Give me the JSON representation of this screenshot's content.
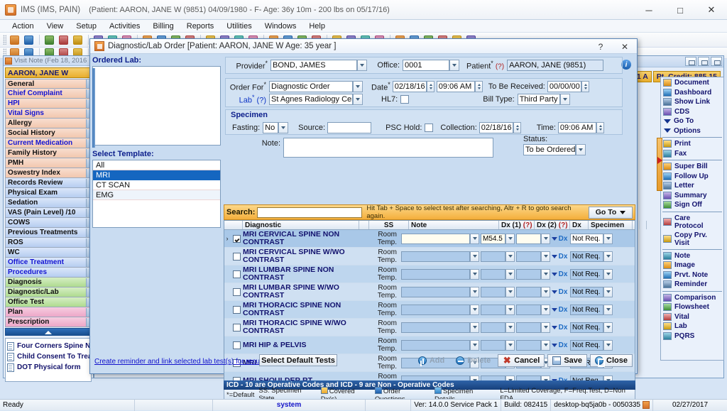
{
  "app": {
    "title": "IMS (IMS, PAIN)",
    "patient_header": "(Patient: AARON, JANE W (9851) 04/09/1980 - F- Age: 36y 10m - 200 lbs on 05/17/16)",
    "window_controls": [
      "minimize-icon",
      "maximize-icon",
      "close-icon"
    ]
  },
  "menu": [
    "Action",
    "View",
    "Setup",
    "Activities",
    "Billing",
    "Reports",
    "Utilities",
    "Windows",
    "Help"
  ],
  "visit_note": {
    "window_title": "Visit Note (Feb 18, 2016",
    "patient": "AARON, JANE W",
    "items": [
      {
        "label": "General",
        "style": "orange",
        "color": "black"
      },
      {
        "label": "Chief Complaint",
        "style": "orange",
        "color": "blue"
      },
      {
        "label": "HPI",
        "style": "orange",
        "color": "blue"
      },
      {
        "label": "Vital Signs",
        "style": "orange",
        "color": "blue"
      },
      {
        "label": "Allergy",
        "style": "orange",
        "color": "black"
      },
      {
        "label": "Social History",
        "style": "orange",
        "color": "black"
      },
      {
        "label": "Current Medication",
        "style": "orange",
        "color": "blue"
      },
      {
        "label": "Family History",
        "style": "orange",
        "color": "black"
      },
      {
        "label": "PMH",
        "style": "orange",
        "color": "black"
      },
      {
        "label": "Oswestry Index",
        "style": "orange",
        "color": "black"
      },
      {
        "label": "Records Review",
        "style": "blue",
        "color": "black"
      },
      {
        "label": "Physical Exam",
        "style": "blue",
        "color": "black"
      },
      {
        "label": "Sedation",
        "style": "blue",
        "color": "black"
      },
      {
        "label": "VAS (Pain Level)  /10",
        "style": "blue",
        "color": "black"
      },
      {
        "label": "COWS",
        "style": "blue",
        "color": "black"
      },
      {
        "label": "Previous Treatments",
        "style": "blue",
        "color": "black"
      },
      {
        "label": "ROS",
        "style": "blue",
        "color": "black"
      },
      {
        "label": "WC",
        "style": "blue",
        "color": "black"
      },
      {
        "label": "Office Treatment",
        "style": "blue",
        "color": "blue"
      },
      {
        "label": "Procedures",
        "style": "blue",
        "color": "blue"
      },
      {
        "label": "Diagnosis",
        "style": "green",
        "color": "black"
      },
      {
        "label": "Diagnostic/Lab",
        "style": "green",
        "color": "black"
      },
      {
        "label": "Office Test",
        "style": "green",
        "color": "black"
      },
      {
        "label": "Plan",
        "style": "pink",
        "color": "black"
      },
      {
        "label": "Prescription",
        "style": "pink",
        "color": "black"
      }
    ],
    "documents": [
      "Four Corners Spine New",
      "Child Consent To Treat",
      "DOT Physical form"
    ]
  },
  "patient_bar": {
    "room": "1 A",
    "credit": "Pt. Credit: 885.15"
  },
  "right_sidebar": {
    "items": [
      {
        "label": "Document",
        "icon": "document-icon",
        "type": "icon"
      },
      {
        "label": "Dashboard",
        "icon": "dashboard-icon",
        "type": "icon"
      },
      {
        "label": "Show Link",
        "icon": "link-icon",
        "type": "icon"
      },
      {
        "label": "CDS",
        "icon": "cds-icon",
        "type": "icon"
      },
      {
        "label": "Go To",
        "icon": "caret-down-icon",
        "type": "caret"
      },
      {
        "label": "Options",
        "icon": "caret-down-icon",
        "type": "caret"
      },
      {
        "label": "Print",
        "icon": "print-icon",
        "type": "icon",
        "divider_before": true
      },
      {
        "label": "Fax",
        "icon": "fax-icon",
        "type": "icon"
      },
      {
        "label": "Super Bill",
        "icon": "superbill-icon",
        "type": "icon",
        "divider_before": true
      },
      {
        "label": "Follow Up",
        "icon": "calendar-icon",
        "type": "icon"
      },
      {
        "label": "Letter",
        "icon": "letter-icon",
        "type": "icon"
      },
      {
        "label": "Summary",
        "icon": "summary-icon",
        "type": "icon"
      },
      {
        "label": "Sign Off",
        "icon": "signoff-icon",
        "type": "icon"
      },
      {
        "label": "Care Protocol",
        "icon": "care-protocol-icon",
        "type": "icon2",
        "divider_before": true
      },
      {
        "label": "Copy Prv. Visit",
        "icon": "copy-icon",
        "type": "icon2"
      },
      {
        "label": "Note",
        "icon": "note-icon",
        "type": "icon",
        "divider_before": true
      },
      {
        "label": "Image",
        "icon": "image-icon",
        "type": "icon"
      },
      {
        "label": "Prvt. Note",
        "icon": "private-note-icon",
        "type": "icon"
      },
      {
        "label": "Reminder",
        "icon": "reminder-icon",
        "type": "icon"
      },
      {
        "label": "Comparison",
        "icon": "comparison-icon",
        "type": "icon",
        "divider_before": true
      },
      {
        "label": "Flowsheet",
        "icon": "flowsheet-icon",
        "type": "icon"
      },
      {
        "label": "Vital",
        "icon": "vital-icon",
        "type": "icon"
      },
      {
        "label": "Lab",
        "icon": "lab-icon",
        "type": "icon"
      },
      {
        "label": "PQRS",
        "icon": "pqrs-icon",
        "type": "icon"
      }
    ]
  },
  "dialog": {
    "title": "Diagnostic/Lab Order  [Patient: AARON, JANE W  Age: 35 year ]",
    "help_label": "?",
    "close_label": "✕",
    "ordered_lab_label": "Ordered Lab:",
    "select_template_label": "Select Template:",
    "templates": [
      {
        "label": "All",
        "selected": false
      },
      {
        "label": "MRI",
        "selected": true
      },
      {
        "label": "CT SCAN",
        "selected": false
      },
      {
        "label": "EMG",
        "selected": false
      }
    ],
    "form": {
      "provider_label": "Provider",
      "provider_value": "BOND, JAMES",
      "office_label": "Office:",
      "office_value": "0001",
      "patient_label": "Patient",
      "patient_hint": "(?)",
      "patient_value": "AARON, JANE  (9851)",
      "order_for_label": "Order For",
      "order_for_value": "Diagnostic Order",
      "date_label": "Date",
      "date_value": "02/18/16",
      "time_value": "09:06 AM",
      "to_be_received_label": "To Be Received:",
      "to_be_received_value": "00/00/00",
      "lab_label": "Lab",
      "lab_hint": "(?)",
      "lab_value": "St Agnes Radiology Center",
      "hl7_label": "HL7:",
      "bill_type_label": "Bill Type:",
      "bill_type_value": "Third Party",
      "specimen_label": "Specimen",
      "fasting_label": "Fasting:",
      "fasting_value": "No",
      "source_label": "Source:",
      "source_value": "",
      "psc_hold_label": "PSC Hold:",
      "collection_label": "Collection:",
      "collection_value": "02/18/16",
      "coll_time_label": "Time:",
      "coll_time_value": "09:06 AM",
      "note_label": "Note:",
      "note_value": "",
      "status_label": "Status:",
      "status_value": "To be Ordered",
      "info_icon": "info-icon"
    },
    "search": {
      "label": "Search:",
      "value": "",
      "hint": "Hit Tab + Space to select test after searching, Altr + R to goto search again.",
      "goto_label": "Go To"
    },
    "grid": {
      "columns": [
        "",
        "",
        "Diagnostic",
        "",
        "SS",
        "Note",
        "Dx (1)",
        "(?)",
        "Dx (2)",
        "(?)",
        "Dx",
        "Specimen",
        "",
        ""
      ],
      "rows": [
        {
          "checked": true,
          "selected": true,
          "name": "MRI CERVICAL SPINE NON CONTRAST",
          "ss": "Room Temp.",
          "note": "",
          "dx1": "M54.5",
          "dx2": "",
          "specimen": "Not Req."
        },
        {
          "checked": false,
          "selected": false,
          "name": "MRI CERVICAL SPINE W/WO CONTRAST",
          "ss": "Room Temp.",
          "note": "",
          "dx1": "",
          "dx2": "",
          "specimen": "Not Req."
        },
        {
          "checked": false,
          "selected": false,
          "name": "MRI LUMBAR SPINE NON CONTRAST",
          "ss": "Room Temp.",
          "note": "",
          "dx1": "",
          "dx2": "",
          "specimen": "Not Req."
        },
        {
          "checked": false,
          "selected": false,
          "name": "MRI LUMBAR SPINE W/WO CONTRAST",
          "ss": "Room Temp.",
          "note": "",
          "dx1": "",
          "dx2": "",
          "specimen": "Not Req."
        },
        {
          "checked": false,
          "selected": false,
          "name": "MRI THORACIC SPINE NON CONTRAST",
          "ss": "Room Temp.",
          "note": "",
          "dx1": "",
          "dx2": "",
          "specimen": "Not Req."
        },
        {
          "checked": false,
          "selected": false,
          "name": "MRI THORACIC SPINE W/WO CONTRAST",
          "ss": "Room Temp.",
          "note": "",
          "dx1": "",
          "dx2": "",
          "specimen": "Not Req."
        },
        {
          "checked": false,
          "selected": false,
          "name": "MRI HIP & PELVIS",
          "ss": "Room Temp.",
          "note": "",
          "dx1": "",
          "dx2": "",
          "specimen": "Not Req."
        },
        {
          "checked": false,
          "selected": false,
          "name": "MRI SHOULDER LT",
          "ss": "Room Temp.",
          "note": "",
          "dx1": "",
          "dx2": "",
          "specimen": "Not Req."
        },
        {
          "checked": false,
          "selected": false,
          "name": "MRI SHOULDER RT",
          "ss": "Room Temp.",
          "note": "",
          "dx1": "",
          "dx2": "",
          "specimen": "Not Req."
        }
      ]
    },
    "legend": {
      "banner": "ICD - 10 are Operative Codes and ICD - 9 are Non - Operative Codes",
      "default_note": "*=Default",
      "ss_note": "SS: Specimen State",
      "covered": "Covered Dx(s)",
      "order_questions": "Order Questions",
      "specimen_details": "Specimen Details",
      "coverage": "L=Limited Coverage, F=Freq.Test, D=Non FDA"
    },
    "footer": {
      "recursive_link": "Create reminder and link selected lab test(s) for recursive order.",
      "select_default_tests": "Select Default Tests",
      "add": "Add",
      "delete": "Delete",
      "cancel": "Cancel",
      "save": "Save",
      "close": "Close"
    }
  },
  "statusbar": {
    "ready": "Ready",
    "system": "system",
    "version": "Ver: 14.0.0 Service Pack 1",
    "build": "Build: 082415",
    "machine": "desktop-bq5ja0b - 0050335",
    "date": "02/27/2017"
  },
  "colors": {
    "accent_blue": "#1566c0",
    "search_gold": "#f4ae3b",
    "patient_gold": "#e9ae2e",
    "banner_blue": "#17407c"
  }
}
